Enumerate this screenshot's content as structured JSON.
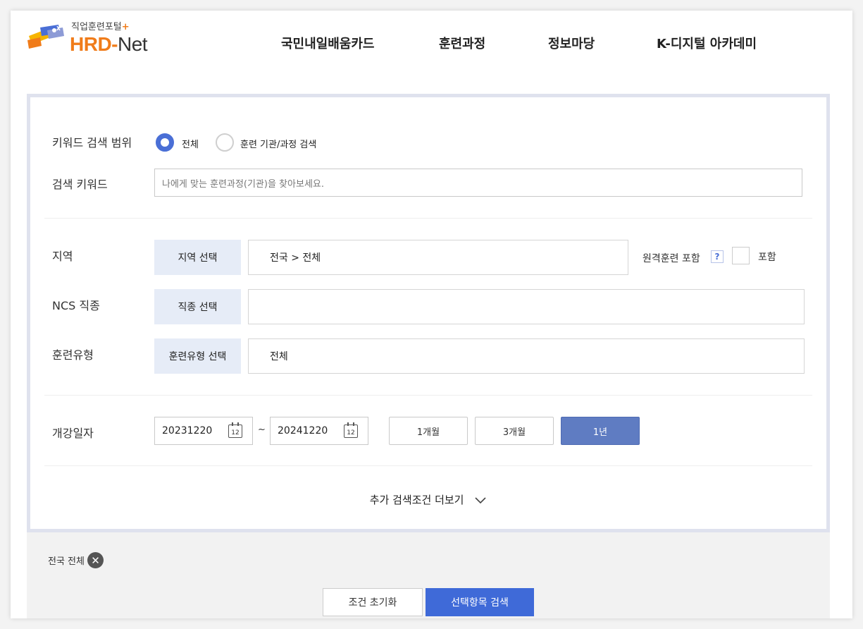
{
  "header": {
    "logo_sub": "직업훈련포털",
    "logo_plus": "+",
    "logo_main": "HRD-",
    "logo_net": "Net",
    "nav": [
      "국민내일배움카드",
      "훈련과정",
      "정보마당",
      "K-디지털 아카데미"
    ]
  },
  "keyword_scope": {
    "label": "키워드 검색 범위",
    "options": [
      {
        "label": "전체",
        "selected": true
      },
      {
        "label": "훈련 기관/과정 검색",
        "selected": false
      }
    ]
  },
  "keyword": {
    "label": "검색 키워드",
    "placeholder": "나에게 맞는 훈련과정(기관)을 찾아보세요."
  },
  "region": {
    "label": "지역",
    "button": "지역 선택",
    "value": "전국 > 전체",
    "remote_label": "원격훈련 포함",
    "help": "?",
    "include_label": "포함",
    "include_checked": false
  },
  "ncs": {
    "label": "NCS 직종",
    "button": "직종 선택",
    "value": ""
  },
  "training_type": {
    "label": "훈련유형",
    "button": "훈련유형 선택",
    "value": "전체"
  },
  "start_date": {
    "label": "개강일자",
    "from": "20231220",
    "to": "20241220",
    "separator": "~",
    "calendar_icon_day": "12",
    "periods": [
      "1개월",
      "3개월",
      "1년"
    ],
    "active_period": "1년"
  },
  "more_label": "추가 검색조건 더보기",
  "bottom": {
    "tag": "전국 전체",
    "reset": "조건 초기화",
    "search": "선택항목 검색"
  },
  "colors": {
    "accent": "#3f6ad8",
    "brand_orange": "#f07c1a",
    "select_button_bg": "#e6ecf7",
    "active_period_bg": "#5f7cc2"
  }
}
